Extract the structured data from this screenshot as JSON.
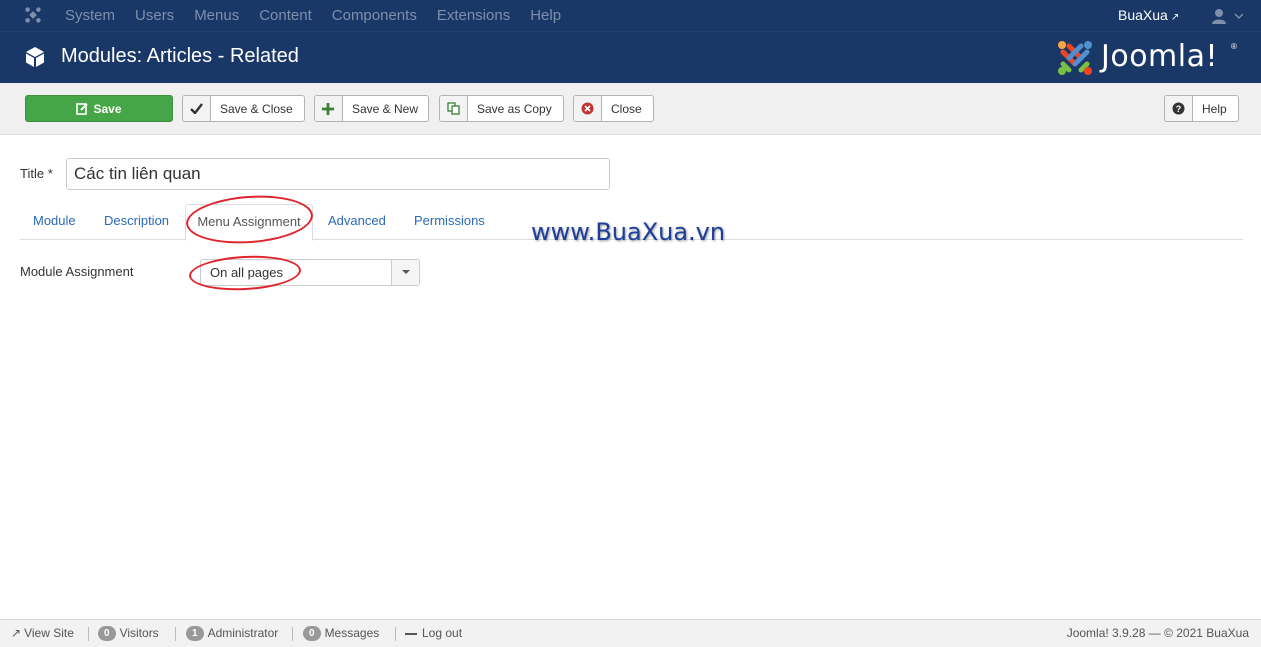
{
  "navbar": {
    "menu": [
      "System",
      "Users",
      "Menus",
      "Content",
      "Components",
      "Extensions",
      "Help"
    ],
    "site_name": "BuaXua"
  },
  "header": {
    "title": "Modules: Articles - Related",
    "brand": "Joomla!"
  },
  "toolbar": {
    "save_label": "Save",
    "save_close_label": "Save & Close",
    "save_new_label": "Save & New",
    "save_copy_label": "Save as Copy",
    "close_label": "Close",
    "help_label": "Help"
  },
  "form": {
    "title_label": "Title *",
    "title_value": "Các tin liên quan"
  },
  "tabs": [
    "Module",
    "Description",
    "Menu Assignment",
    "Advanced",
    "Permissions"
  ],
  "active_tab": "Menu Assignment",
  "assignment": {
    "label": "Module Assignment",
    "selected": "On all pages"
  },
  "watermark": "www.BuaXua.vn",
  "statusbar": {
    "view_site": "View Site",
    "visitors_count": "0",
    "visitors_label": "Visitors",
    "admin_count": "1",
    "admin_label": "Administrator",
    "messages_count": "0",
    "messages_label": "Messages",
    "logout": "Log out",
    "footer": "Joomla! 3.9.28 — © 2021 BuaXua"
  },
  "colors": {
    "navbar_bg": "#1a3867",
    "save_green": "#46a546",
    "tab_link": "#2a69b8",
    "highlight_red": "#e0242c"
  }
}
